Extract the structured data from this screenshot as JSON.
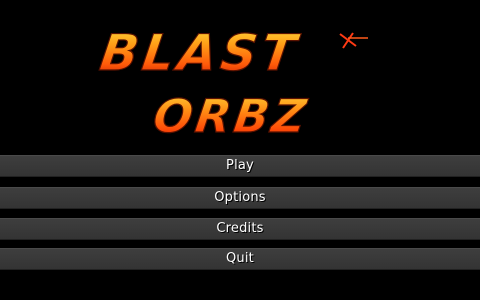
{
  "logo": {
    "line1": "BLAST",
    "line2": "ORBZ",
    "colors": {
      "top": "#ffc21a",
      "mid": "#ff7a10",
      "bottom": "#d21800",
      "outline": "#5a1200"
    }
  },
  "menu": {
    "items": [
      {
        "label": "Play"
      },
      {
        "label": "Options"
      },
      {
        "label": "Credits"
      },
      {
        "label": "Quit"
      }
    ]
  },
  "colors": {
    "background": "#000000",
    "button_bg": "#3a3a3a",
    "button_text": "#ffffff"
  }
}
